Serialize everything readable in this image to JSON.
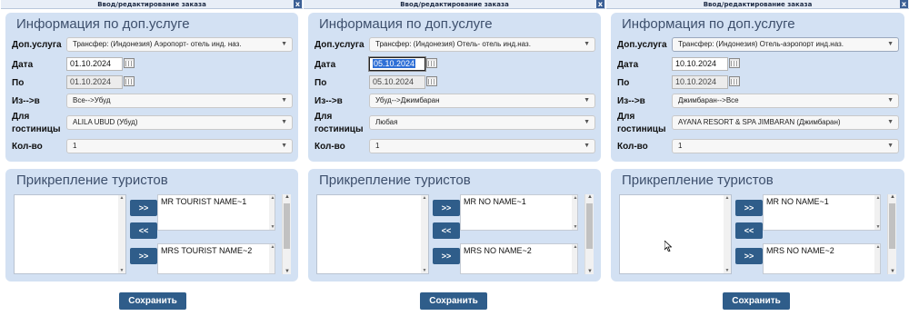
{
  "window_title": "Ввод/редактирование заказа",
  "close_label": "x",
  "section_info": "Информация по доп.услуге",
  "section_tourists": "Прикрепление туристов",
  "labels": {
    "service": "Доп.услуга",
    "date": "Дата",
    "to": "По",
    "from_to": "Из-->в",
    "hotel_line1": "Для",
    "hotel_line2": "гостиницы",
    "qty": "Кол-во"
  },
  "btn_add": ">>",
  "btn_remove": "<<",
  "save_label": "Сохранить",
  "panels": [
    {
      "service": "Трансфер: (Индонезия) Аэропорт- отель инд. наз.",
      "date": "01.10.2024",
      "to": "01.10.2024",
      "from_to": "Все-->Убуд",
      "hotel": "ALILA UBUD (Убуд)",
      "qty": "1",
      "tourist1": "MR TOURIST NAME~1",
      "tourist2": "MRS TOURIST NAME~2"
    },
    {
      "service": "Трансфер: (Индонезия) Отель- отель инд.наз.",
      "date": "05.10.2024",
      "to": "05.10.2024",
      "from_to": "Убуд-->Джимбаран",
      "hotel": "Любая",
      "qty": "1",
      "tourist1": "MR NO NAME~1",
      "tourist2": "MRS NO NAME~2"
    },
    {
      "service": "Трансфер: (Индонезия) Отель-аэропорт инд.наз.",
      "date": "10.10.2024",
      "to": "10.10.2024",
      "from_to": "Джимбаран-->Все",
      "hotel": "AYANA RESORT & SPA JIMBARAN (Джимбаран)",
      "qty": "1",
      "tourist1": "MR NO NAME~1",
      "tourist2": "MRS NO NAME~2"
    }
  ],
  "colors": {
    "card_bg": "#d3e1f3",
    "button_bg": "#2f5d8a",
    "title_text": "#3d4f6c"
  }
}
